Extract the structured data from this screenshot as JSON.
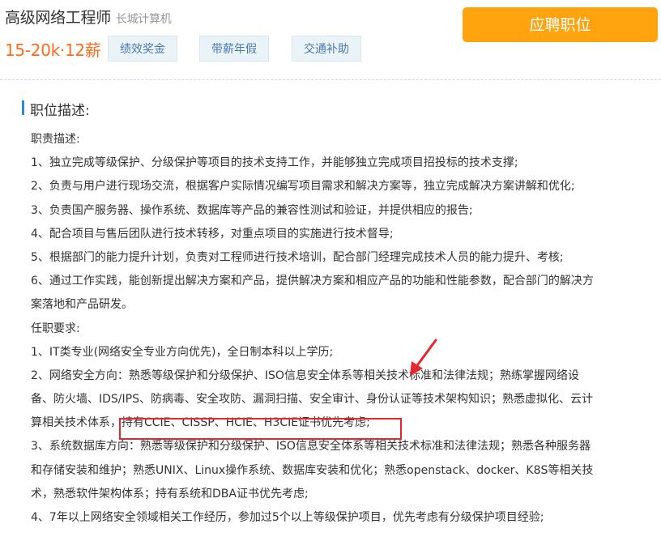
{
  "job": {
    "title": "高级网络工程师",
    "company": "长城计算机",
    "salary": "15-20k·12薪",
    "tags": [
      "绩效奖金",
      "带薪年假",
      "交通补助"
    ],
    "apply_label": "应聘职位"
  },
  "section_title": "职位描述:",
  "description_lines": [
    "职责描述:",
    "1、独立完成等级保护、分级保护等项目的技术支持工作，并能够独立完成项目招投标的技术支撑;",
    "2、负责与用户进行现场交流，根据客户实际情况编写项目需求和解决方案等，独立完成解决方案讲解和优化;",
    "3、负责国产服务器、操作系统、数据库等产品的兼容性测试和验证，并提供相应的报告;",
    "4、配合项目与售后团队进行技术转移，对重点项目的实施进行技术督导;",
    "5、根据部门的能力提升计划，负责对工程师进行技术培训，配合部门经理完成技术人员的能力提升、考核;",
    "6、通过工作实践，能创新提出解决方案和产品，提供解决方案和相应产品的功能和性能参数，配合部门的解决方",
    "案落地和产品研发。",
    "任职要求:",
    "1、IT类专业(网络安全专业方向优先)，全日制本科以上学历;",
    "2、网络安全方向：熟悉等级保护和分级保护、ISO信息安全体系等相关技术标准和法律法规；熟练掌握网络设",
    "备、防火墙、IDS/IPS、防病毒、安全攻防、漏洞扫描、安全审计、身份认证等技术架构知识；熟悉虚拟化、云计",
    "算相关技术体系，持有CCIE、CISSP、HCIE、H3CIE证书优先考虑;",
    "3、系统数据库方向：熟悉等级保护和分级保护、ISO信息安全体系等相关技术标准和法律法规；熟悉各种服务器",
    "和存储安装和维护；熟悉UNIX、Linux操作系统、数据库安装和优化；熟悉openstack、docker、K8S等相关技",
    "术，熟悉软件架构体系；持有系统和DBA证书优先考虑;",
    "4、7年以上网络安全领域相关工作经历，参加过5个以上等级保护项目，优先考虑有分级保护项目经验;"
  ],
  "colors": {
    "salary": "#fc6c1c",
    "apply_button": "#ffa40f",
    "tag_text": "#4c7aae",
    "tag_bg": "#e9f3f8",
    "section_bar": "#2b8bd8",
    "annotation": "#e8262d"
  }
}
